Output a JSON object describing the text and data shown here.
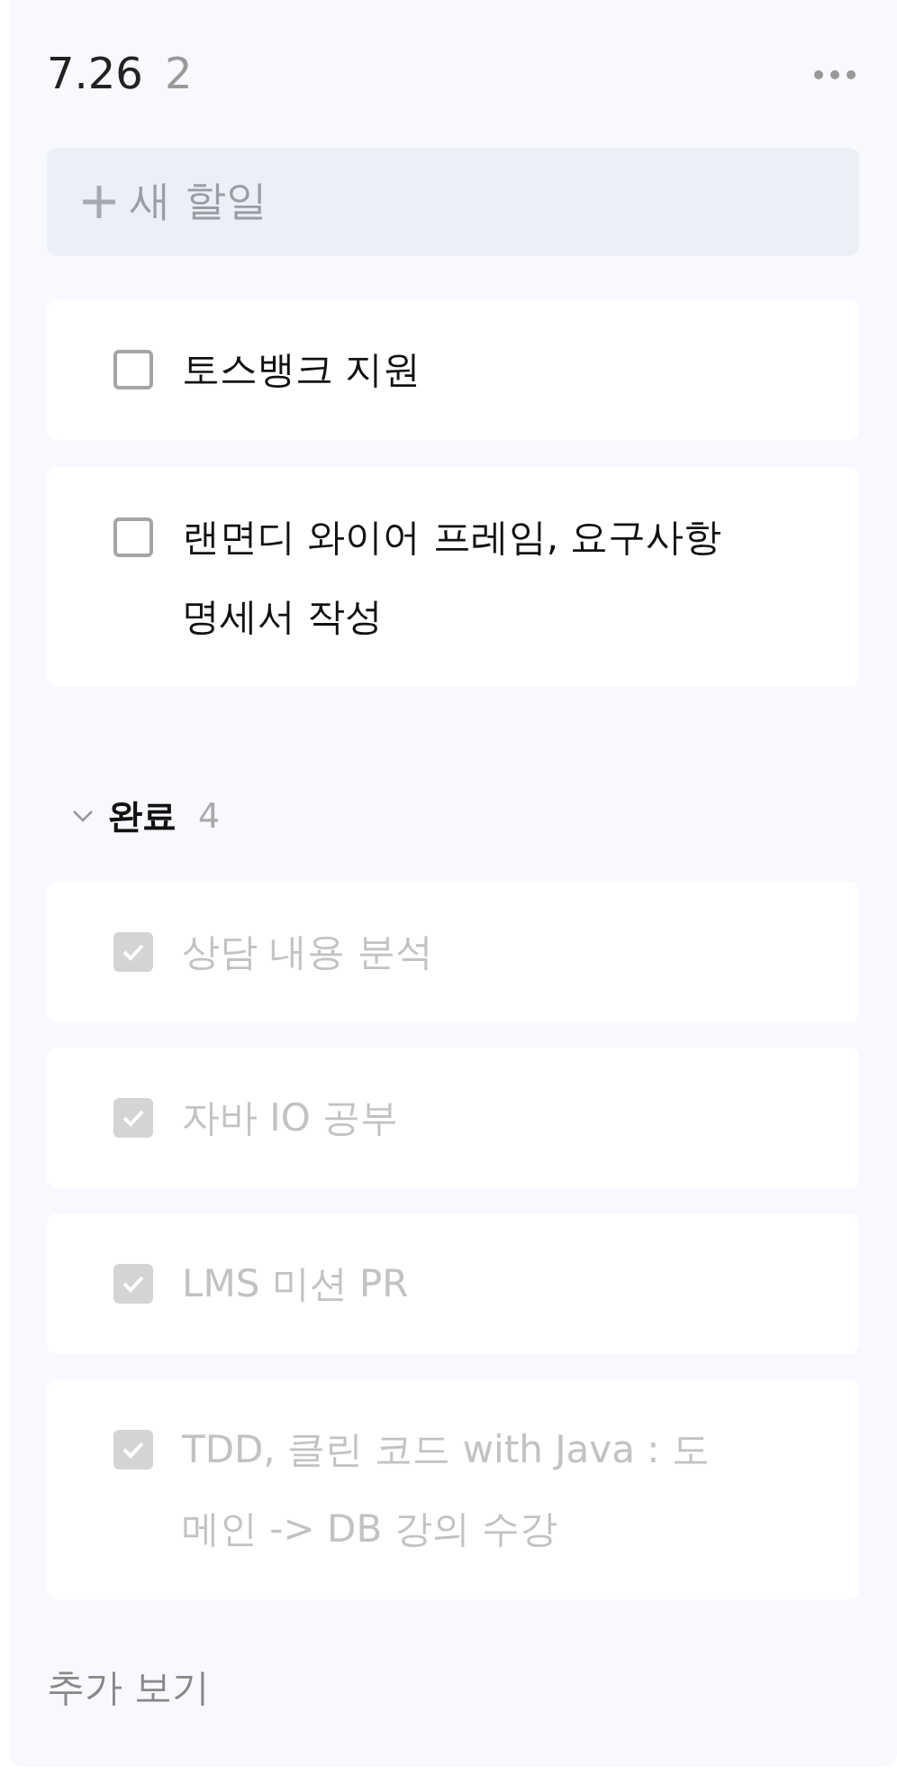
{
  "header": {
    "title": "7.26",
    "count": "2"
  },
  "new_task": {
    "placeholder": "새 할일"
  },
  "tasks": [
    {
      "text": "토스뱅크 지원",
      "checked": false
    },
    {
      "text": "랜면디 와이어 프레임, 요구사항 명세서 작성",
      "checked": false
    }
  ],
  "completed": {
    "label": "완료",
    "count": "4",
    "expanded": true,
    "tasks": [
      {
        "text": "상담 내용 분석",
        "checked": true
      },
      {
        "text": "자바 IO 공부",
        "checked": true
      },
      {
        "text": "LMS 미션 PR",
        "checked": true
      },
      {
        "text": "TDD, 클린 코드 with Java : 도메인 -> DB 강의 수강",
        "checked": true
      }
    ]
  },
  "more_link": "추가 보기"
}
